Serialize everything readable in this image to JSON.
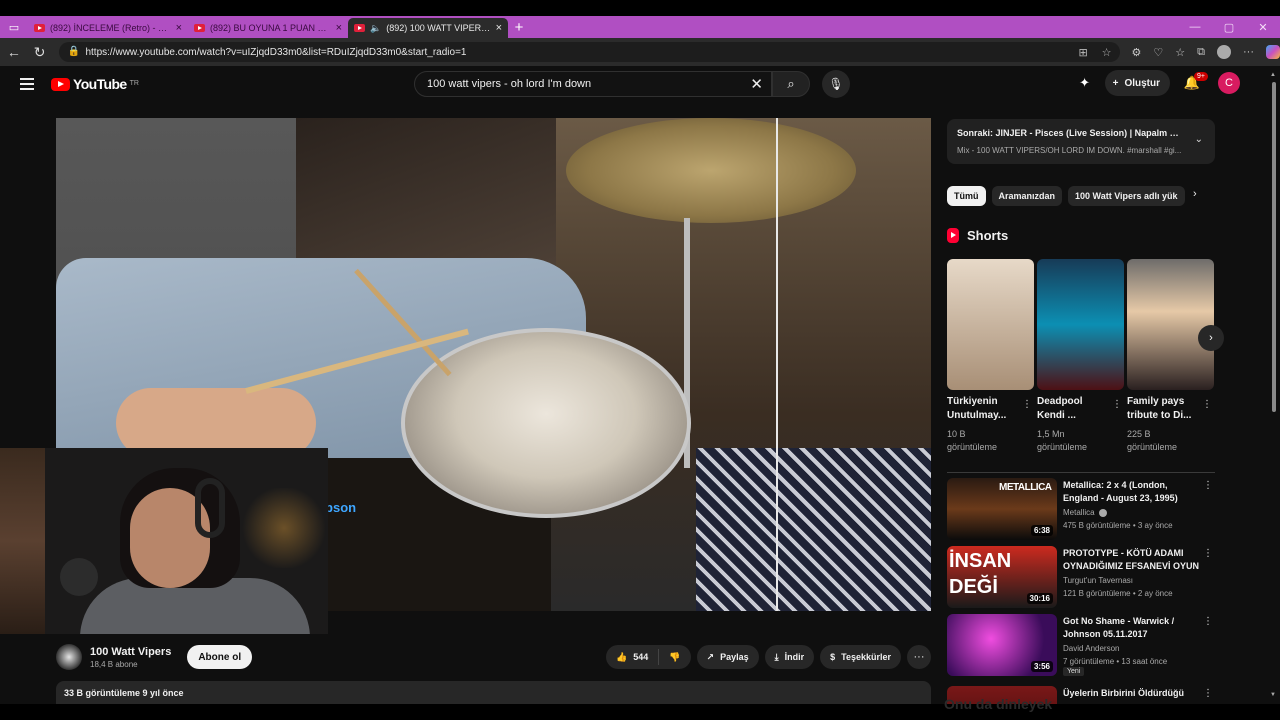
{
  "browser": {
    "tabs": [
      {
        "title": "(892) İNCELEME (Retro) - MAX PA",
        "active": false
      },
      {
        "title": "(892) BU OYUNA 1 PUAN VERİYO",
        "active": false
      },
      {
        "title": "(892) 100 WATT VIPERS/OH",
        "active": true
      }
    ],
    "url": "https://www.youtube.com/watch?v=uIZjqdD33m0&list=RDuIZjqdD33m0&start_radio=1"
  },
  "youtube": {
    "logo_text": "YouTube",
    "country_code": "TR",
    "search_value": "100 watt vipers - oh lord I'm down",
    "create_label": "Oluştur",
    "notif_count": "9+",
    "avatar_letter": "C"
  },
  "player": {
    "caption_text": "shall #gibson"
  },
  "channel": {
    "name": "100 Watt Vipers",
    "subs": "18,4 B abone",
    "subscribe_label": "Abone ol",
    "likes": "544",
    "share_label": "Paylaş",
    "download_label": "İndir",
    "thanks_label": "Teşekkürler"
  },
  "description": {
    "summary": "33 B görüntüleme  9 yıl önce"
  },
  "upnext": {
    "title": "Sonraki: JINJER - Pisces (Live Session) | Napalm R...",
    "subtitle": "Mix - 100 WATT VIPERS/OH LORD IM DOWN. #marshall #gi..."
  },
  "chips": [
    "Tümü",
    "Aramanızdan",
    "100 Watt Vipers adlı yük"
  ],
  "shorts": {
    "title": "Shorts",
    "items": [
      {
        "title": "Türkiyenin Unutulmay...",
        "views": "10 B",
        "views_suffix": "görüntüleme"
      },
      {
        "title": "Deadpool Kendi ...",
        "views": "1,5 Mn",
        "views_suffix": "görüntüleme"
      },
      {
        "title": "Family pays tribute to Di...",
        "views": "225 B",
        "views_suffix": "görüntüleme"
      }
    ]
  },
  "videos": [
    {
      "title": "Metallica: 2 x 4 (London, England - August 23, 1995)",
      "channel": "Metallica",
      "meta": "475 B görüntüleme • 3 ay önce",
      "duration": "6:38",
      "thumb_text": "METALLICA"
    },
    {
      "title": "PROTOTYPE - KÖTÜ ADAMI OYNADIĞIMIZ EFSANEVİ OYUN",
      "channel": "Turgut'un Tavernası",
      "meta": "121 B görüntüleme • 2 ay önce",
      "duration": "30:16",
      "thumb_text": "İNSAN DEĞİ"
    },
    {
      "title": "Got No Shame - Warwick / Johnson 05.11.2017",
      "channel": "David Anderson",
      "meta": "7 görüntüleme • 13 saat önce",
      "duration": "3:56",
      "badge": "Yeni"
    },
    {
      "title": "Üyelerin Birbirini Öldürdüğü"
    }
  ],
  "overlay": {
    "listen_text": "Onu da dinleyek"
  },
  "colors": {
    "tabbar": "#b04fc2",
    "youtube_red": "#ff0000",
    "link_blue": "#3ea6ff",
    "avatar_pink": "#d81b60"
  }
}
